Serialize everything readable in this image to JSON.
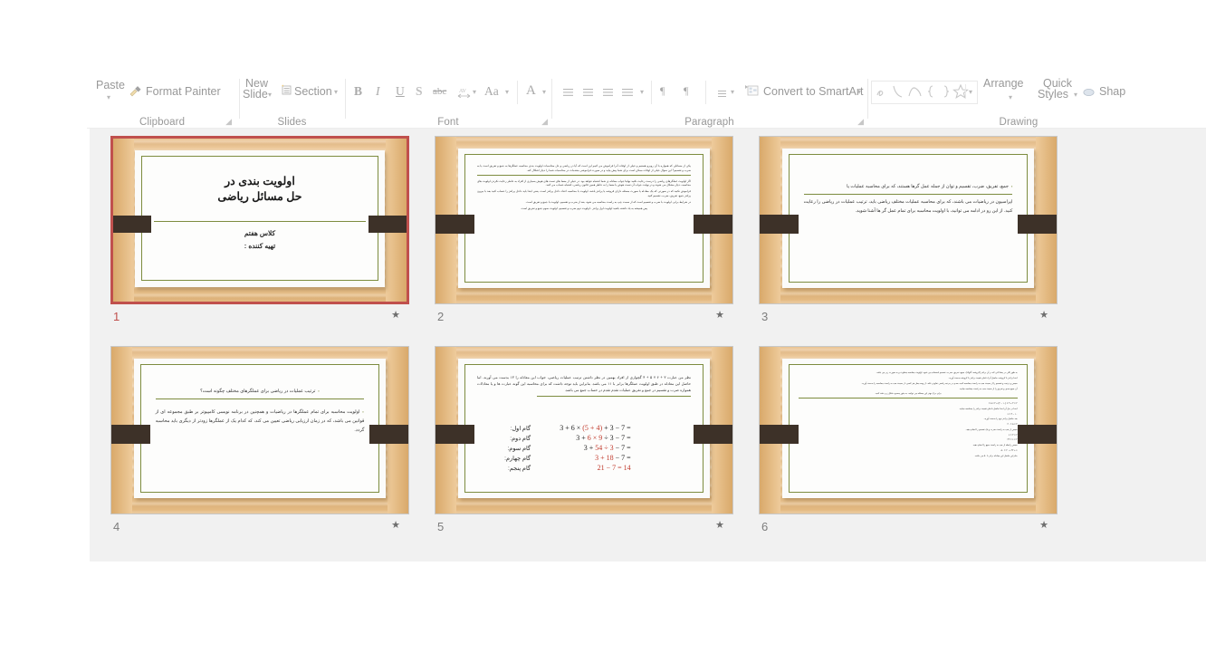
{
  "app": "PowerPoint Slide Sorter",
  "ribbon": {
    "groups": [
      {
        "name": "Clipboard",
        "label": "Clipboard"
      },
      {
        "name": "Slides",
        "label": "Slides"
      },
      {
        "name": "Font",
        "label": "Font"
      },
      {
        "name": "Paragraph",
        "label": "Paragraph"
      },
      {
        "name": "Drawing",
        "label": "Drawing"
      }
    ],
    "clipboard": {
      "paste_label": "Paste",
      "format_painter_label": "Format Painter",
      "format_painter_icon": "paintbrush-icon",
      "dialog_launcher_icon": "dialog-launcher-icon"
    },
    "slides": {
      "new_slide_label_top": "New",
      "new_slide_label_bottom": "Slide",
      "section_label": "Section",
      "section_icon": "section-icon",
      "caret": "▾"
    },
    "font": {
      "bold": "B",
      "italic": "I",
      "underline": "U",
      "shadow": "S",
      "strikethrough": "abc",
      "character_spacing_icon": "character-spacing-icon",
      "change_case": "Aa",
      "font_color": "A",
      "dialog_launcher_icon": "dialog-launcher-icon"
    },
    "paragraph": {
      "bullets_icon": "bullet-list-icon",
      "numbering_icon": "numbered-list-icon",
      "decrease_indent_icon": "decrease-indent-icon",
      "increase_indent_icon": "increase-indent-icon",
      "ltr_icon": "¶",
      "rtl_icon": "¶",
      "line_spacing_icon": "line-spacing-icon",
      "convert_to_smartart_label": "Convert to SmartArt",
      "convert_to_smartart_icon": "smartart-icon",
      "dialog_launcher_icon": "dialog-launcher-icon"
    },
    "drawing": {
      "shapes": [
        "scribble-icon",
        "curve-icon",
        "arc-icon",
        "left-brace-icon",
        "right-brace-icon",
        "star-icon"
      ],
      "more_caret": "▾",
      "arrange_label": "Arrange",
      "quick_styles_label_top": "Quick",
      "quick_styles_label_bottom": "Styles",
      "shape_fill_label": "Shap",
      "shape_fill_icon": "shape-fill-icon"
    }
  },
  "sorter": {
    "selected_slide": 1,
    "slides": [
      {
        "number": "1",
        "star": "★",
        "selected": true,
        "kind": "title",
        "title_lines": [
          "اولویت بندی در",
          "حل مسائل ریاضی"
        ],
        "subtitle_lines": [
          "کلاس هفتم",
          "تهیه کننده :"
        ]
      },
      {
        "number": "2",
        "star": "★",
        "selected": false,
        "kind": "text",
        "paragraphs": [
          "یکی از مسائلی که همواره با آن روبرو هستیم و خیلی از اوقات آنرا فراموش می کنیم این است که آیا در ریاضی و حل محاسبات اولویت بندی محاسبه عملگرها به جمع و تفریق است یا به ضرب و تقسیم؟ این سوال خیلی از اوقات ممکن است برای شما پیش بیاید و در صورت فراموشی مقدمات در محاسبات شما را دچار اشکال کند.",
          "اگر اولویت عملگرهای ریاضی را درست رعایت نکنید نهایتا جواب معادله ی شما اشتباه خواهد بود. در خیلی از معما های تست های هوش بسیاری از افراد به خاطر رعایت نکردن اولویت های محاسبه، دچار مشکل می شوند و در نهایت جواب آن تست هوش یا معما را به خاطر همین قانون ریاضی، اشتباه حساب می کنند.",
          "فراموش نکنید که در صورتی که یک معادله یا صورت مسئله دارای قروشه یا پرانتز باشد، اولویت با محاسبه اعداد داخل پرانتز است. یعنی ابتدا باید داخل پرانتز را حساب کنید بعد با بیرون پرانتز جمع، تفریق، ضرب، تقسیم کنید.",
          "در شرایط برابر، اولویت با ضرب و تقسیم است که از سمت چپ به راست محاسبه می شود، بعد از ضرب و تقسیم، اولویت با جمع و تفریق است.",
          "پس همیشه به یاد داشته باشید اولویت اول پرانتز ، اولویت دوم ضرب و تقسیم، اولویت سوم جمع و تفریق است."
        ],
        "rule_after": 1
      },
      {
        "number": "3",
        "star": "★",
        "selected": false,
        "kind": "text",
        "paragraphs": [
          "جمع، تفریق، ضرب، تقسیم و توان از جمله عمل گرها هستند، که برای محاسبه عملیات یا",
          "اپراسیون در ریاضیات می باشند، که برای محاسبه عملیات مختلف ریاضی باید، ترتیب عملیات در ریاضی را رعایت کنید. از این رو در ادامه می توانید، با اولویت محاسبه برای تمام عمل گر ها آشنا شوید."
        ],
        "bullet_first": true,
        "rule_after": 0,
        "v_offset": "22%"
      },
      {
        "number": "4",
        "star": "★",
        "selected": false,
        "kind": "text",
        "paragraphs": [
          "ترتیب عملیات در ریاضی برای عملگرهای مختلف چگونه است؟",
          "اولویت محاسبه برای تمام عملگرها در ریاضیات و همچنین در برنامه نویسی کامپیوتر بر طبق مجموعه ای از قوانین می باشد، که در زمان ارزیابی ریاضی تعیین می کند، که کدام یک از عملگرها زودتر از دیگری باید محاسبه گردد."
        ],
        "bullet_all": true,
        "rule_after": 0,
        "v_offset": "18%"
      },
      {
        "number": "5",
        "star": "★",
        "selected": false,
        "kind": "equations",
        "paragraphs": [
          "نظر من عبارت ۳ + ۶ × ۵ + ۴ گچواری از افراد بهمین در نظر داشتن ترتیب عملیات ریاضی، جواب این معادله را ۱۳ بدست می آورند. اما حاصل این معادله در طبق اولویت عملگرها برابر با ۱۱ می باشد. بنابراین باید توجه داشت که برای محاسبه این گونه عبارت ها و یا معادلات همواره ضرب و تقسیم در جمع و تفریق عملیات تقدم تقدم در حساب جمع می باشد."
        ],
        "equations": [
          {
            "label": "گام اول:",
            "expr_html": "3 + 6 × <span class=\"red\">(5 + 4)</span> + 3 − 7 ="
          },
          {
            "label": "گام دوم:",
            "expr_html": "3 + <span class=\"red\">6 × 9</span> ÷ 3 − 7 ="
          },
          {
            "label": "گام سوم:",
            "expr_html": "3 + <span class=\"red\">54 ÷ 3</span> − 7 ="
          },
          {
            "label": "گام چهارم:",
            "expr_html": "<span class=\"red\">3 + 18</span> − 7 ="
          },
          {
            "label": "گام پنجم:",
            "expr_html": "<span class=\"red\">21 − 7 = 14</span>"
          }
        ]
      },
      {
        "number": "6",
        "star": "★",
        "selected": false,
        "kind": "dense",
        "paragraphs": [
          "به طور کلی در معادلاتی که در آن پرانتز (کروشه، آکولاد)، جمع، تفریق، ضرب، تقسیم استفاده می شود، اولویت محاسبه متفاوت و به صورت زیر می باشد.",
          "ابتدا پرانتز یا کروشه، حاصل آنرا داخلی قیمت پرانتز یا کروشه بدست آورید.",
          "سپس و ترتیب و تقسیم را از سمت چپ به راست محاسبه کنید، بعدی در مرتبه ریاضی تفاوتی نکند، از وجه محل هر کسی، از سمت چپ به راست محاسبه را بدست آورید.",
          "آن جمع بعدی و تفریق را از سمت چپ به راست محاسبه نمایید.",
          "برای درک بهتر این مسئله می توانید، به مثور محدود شکل زیر دقت کنید."
        ],
        "lines": [
          "۲ × ۳ + ۴ × (۱۰ − ۴) + ۴ × ۵ =",
          "ابتدا در حل آن ابتدا حاصل داخلی قیمت پرانتز را محاسبه نمایید.",
          "۱۰ − ۴ = ۶",
          "بعد حاصل پرانتز نوم را بدست آورید.",
          "۴ × ۵ = ۲۰",
          "سپس از چپ به راست ضرب و یک تقسیم را انجام دهید.",
          "۲ × ۳ = ۶",
          "۴ × ۶ = ۲۴",
          "سپس رابطه از چپ به راست جمع را انجام دهید.",
          "۶ + ۲۴ + ۲۰ = ۵۰",
          "بنابراین حاصل این معادله برابر با ۵۰ می باشد."
        ]
      }
    ]
  },
  "colors": {
    "selection": "#c0504d",
    "pane_bg": "#f1f1f1",
    "slide_wood": "#eecb9b",
    "slide_border_green": "#7d8c3f",
    "slide_bar_brown": "#3d3128",
    "ribbon_text": "#5a5a5a",
    "equation_accent": "#c0392b"
  }
}
